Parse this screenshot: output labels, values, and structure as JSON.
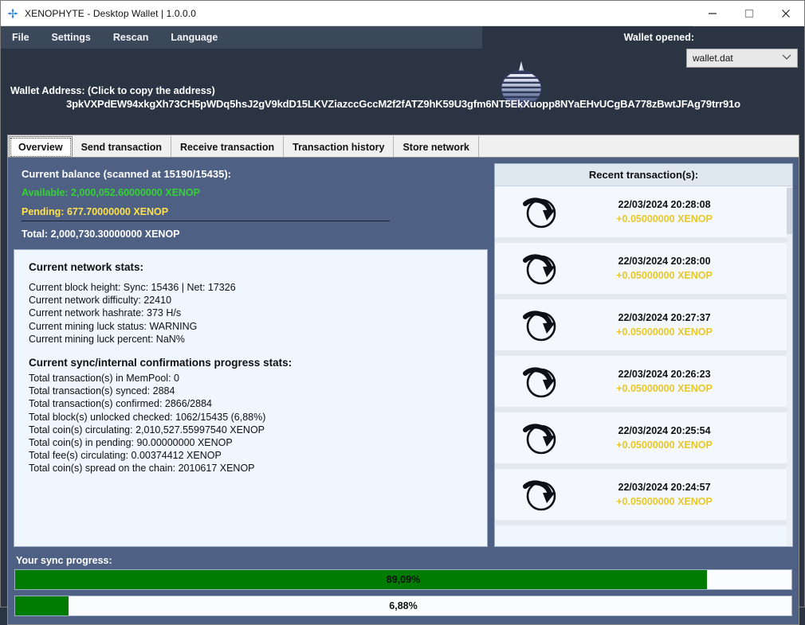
{
  "titlebar": {
    "title": "XENOPHYTE - Desktop Wallet | 1.0.0.0",
    "icon": "app-diamond-icon",
    "minimize": "minimize-icon",
    "maximize": "maximize-icon",
    "close": "close-icon"
  },
  "menu": {
    "items": [
      {
        "label": "File"
      },
      {
        "label": "Settings"
      },
      {
        "label": "Rescan"
      },
      {
        "label": "Language"
      }
    ]
  },
  "wallet": {
    "opened_label": "Wallet opened:",
    "selected_file": "wallet.dat",
    "chevron": "∨",
    "address_label": "Wallet Address: (Click to copy the address)",
    "address": "3pkVXPdEW94xkgXh73CH5pWDq5hsJ2gV9kdD15LKVZiazccGccM2f2fATZ9hK59U3gfm6NT5EkXuopp8NYaEHvUCgBA778zBwtJFAg79trr91o"
  },
  "tabs": [
    {
      "label": "Overview",
      "active": true
    },
    {
      "label": "Send transaction",
      "active": false
    },
    {
      "label": "Receive transaction",
      "active": false
    },
    {
      "label": "Transaction history",
      "active": false
    },
    {
      "label": "Store network",
      "active": false
    }
  ],
  "balance": {
    "title": "Current balance (scanned at 15190/15435):",
    "available": "Available: 2,000,052.60000000 XENOP",
    "pending": "Pending: 677.70000000 XENOP",
    "total": "Total: 2,000,730.30000000 XENOP",
    "available_color": "#35d135",
    "pending_color": "#ffe24d"
  },
  "network_stats": {
    "heading": "Current network stats:",
    "lines": [
      "Current block height: Sync: 15436 | Net: 17326",
      "Current network difficulty: 22410",
      "Current network hashrate: 373 H/s",
      "Current mining luck status: WARNING",
      "Current mining luck percent: NaN%"
    ]
  },
  "sync_stats": {
    "heading": "Current sync/internal confirmations progress stats:",
    "lines": [
      "Total transaction(s) in MemPool: 0",
      "Total transaction(s) synced: 2884",
      "Total transaction(s) confirmed: 2866/2884",
      "Total block(s) unlocked checked: 1062/15435 (6,88%)",
      "Total coin(s) circulating: 2,010,527.55997540 XENOP",
      "Total coin(s) in pending: 90.00000000 XENOP",
      "Total fee(s) circulating: 0.00374412 XENOP",
      "Total coin(s) spread on the chain: 2010617 XENOP"
    ]
  },
  "recent_transactions": {
    "header": "Recent transaction(s):",
    "items": [
      {
        "date": "22/03/2024 20:28:08",
        "amount": "+0.05000000 XENOP",
        "icon": "incoming-transaction-icon"
      },
      {
        "date": "22/03/2024 20:28:00",
        "amount": "+0.05000000 XENOP",
        "icon": "incoming-transaction-icon"
      },
      {
        "date": "22/03/2024 20:27:37",
        "amount": "+0.05000000 XENOP",
        "icon": "incoming-transaction-icon"
      },
      {
        "date": "22/03/2024 20:26:23",
        "amount": "+0.05000000 XENOP",
        "icon": "incoming-transaction-icon"
      },
      {
        "date": "22/03/2024 20:25:54",
        "amount": "+0.05000000 XENOP",
        "icon": "incoming-transaction-icon"
      },
      {
        "date": "22/03/2024 20:24:57",
        "amount": "+0.05000000 XENOP",
        "icon": "incoming-transaction-icon"
      }
    ]
  },
  "progress": {
    "label": "Your sync progress:",
    "bar1_text": "89,09%",
    "bar1_percent": 89.09,
    "bar2_text": "6,88%",
    "bar2_percent": 6.88,
    "fill_color": "#007d00"
  }
}
